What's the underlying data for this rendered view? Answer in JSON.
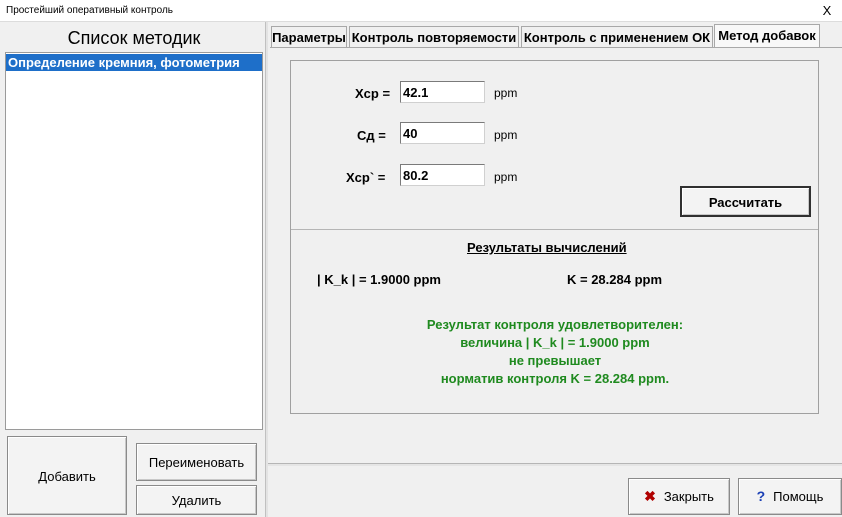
{
  "window": {
    "title": "Простейший оперативный контроль",
    "close_glyph": "X"
  },
  "methods_list": {
    "header": "Список методик",
    "items": [
      "Определение кремния, фотометрия"
    ]
  },
  "left_buttons": {
    "add": "Добавить",
    "rename": "Переименовать",
    "delete": "Удалить"
  },
  "tabs": [
    {
      "label": "Параметры",
      "active": false
    },
    {
      "label": "Контроль повторяемости",
      "active": false
    },
    {
      "label": "Контроль с применением ОК",
      "active": false
    },
    {
      "label": "Метод добавок",
      "active": true
    }
  ],
  "form": {
    "xcp": {
      "label": "Xср =",
      "value": "42.1",
      "unit": "ppm"
    },
    "cd": {
      "label": "Сд =",
      "value": "40",
      "unit": "ppm"
    },
    "xcp2": {
      "label": "Xср` =",
      "value": "80.2",
      "unit": "ppm"
    },
    "calc_button": "Рассчитать"
  },
  "results": {
    "title": "Результаты вычислений",
    "kk": "| K_k | =  1.9000 ppm",
    "k": "K =  28.284 ppm",
    "conclusion": [
      "Результат контроля удовлетворителен:",
      "величина | K_k | = 1.9000 ppm",
      "не превышает",
      "норматив контроля K = 28.284 ppm."
    ],
    "conclusion_color": "#1f8a1f"
  },
  "bottom_buttons": {
    "close": "Закрыть",
    "close_icon": "x-icon",
    "help": "Помощь",
    "help_icon": "question-icon"
  },
  "colors": {
    "selection": "#1e6fc9"
  }
}
